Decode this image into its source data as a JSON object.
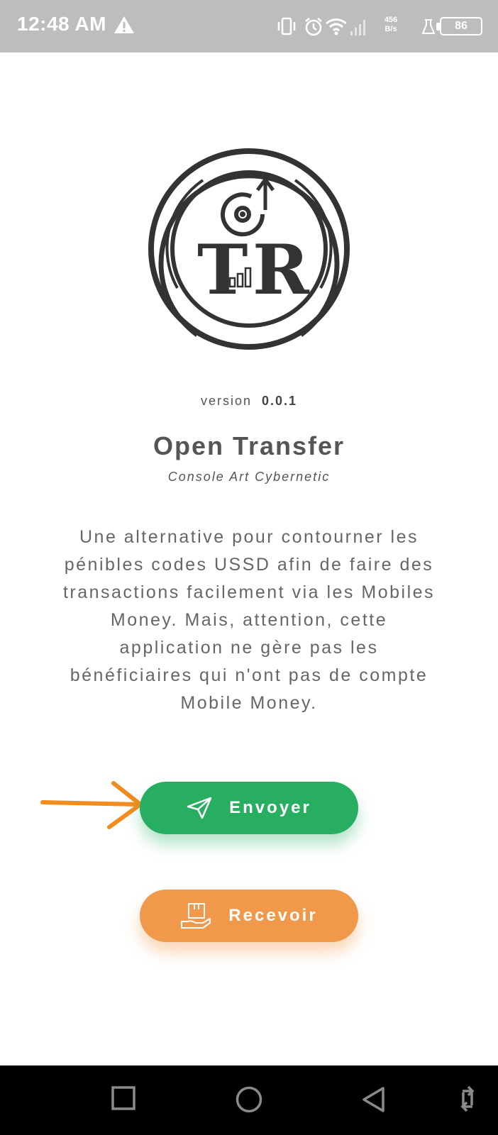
{
  "status_bar": {
    "time": "12:48 AM",
    "net_speed_value": "456",
    "net_speed_unit": "B/s",
    "battery": "86",
    "icons": [
      "warning-icon",
      "vibrate-icon",
      "alarm-icon",
      "wifi-icon",
      "signal-icon",
      "flask-icon",
      "battery-icon"
    ]
  },
  "app": {
    "logo_text_left": "T",
    "logo_text_right": "R",
    "version_label": "version",
    "version_number": "0.0.1",
    "title": "Open Transfer",
    "subtitle": "Console Art Cybernetic",
    "description": "Une alternative pour contourner les pénibles codes USSD afin de faire des transactions facilement via les Mobiles Money. Mais, attention, cette application ne gère pas les bénéficiaires qui n'ont pas de compte Mobile Money."
  },
  "buttons": {
    "send_label": "Envoyer",
    "send_icon": "paper-plane-icon",
    "send_color": "#27ae60",
    "receive_label": "Recevoir",
    "receive_icon": "hand-with-box-icon",
    "receive_color": "#f0994a"
  },
  "annotation": {
    "arrow_color": "#f28c1c"
  },
  "nav_bar": {
    "icons": [
      "square-nav-icon",
      "circle-home-icon",
      "triangle-back-icon",
      "rotate-icon"
    ]
  }
}
